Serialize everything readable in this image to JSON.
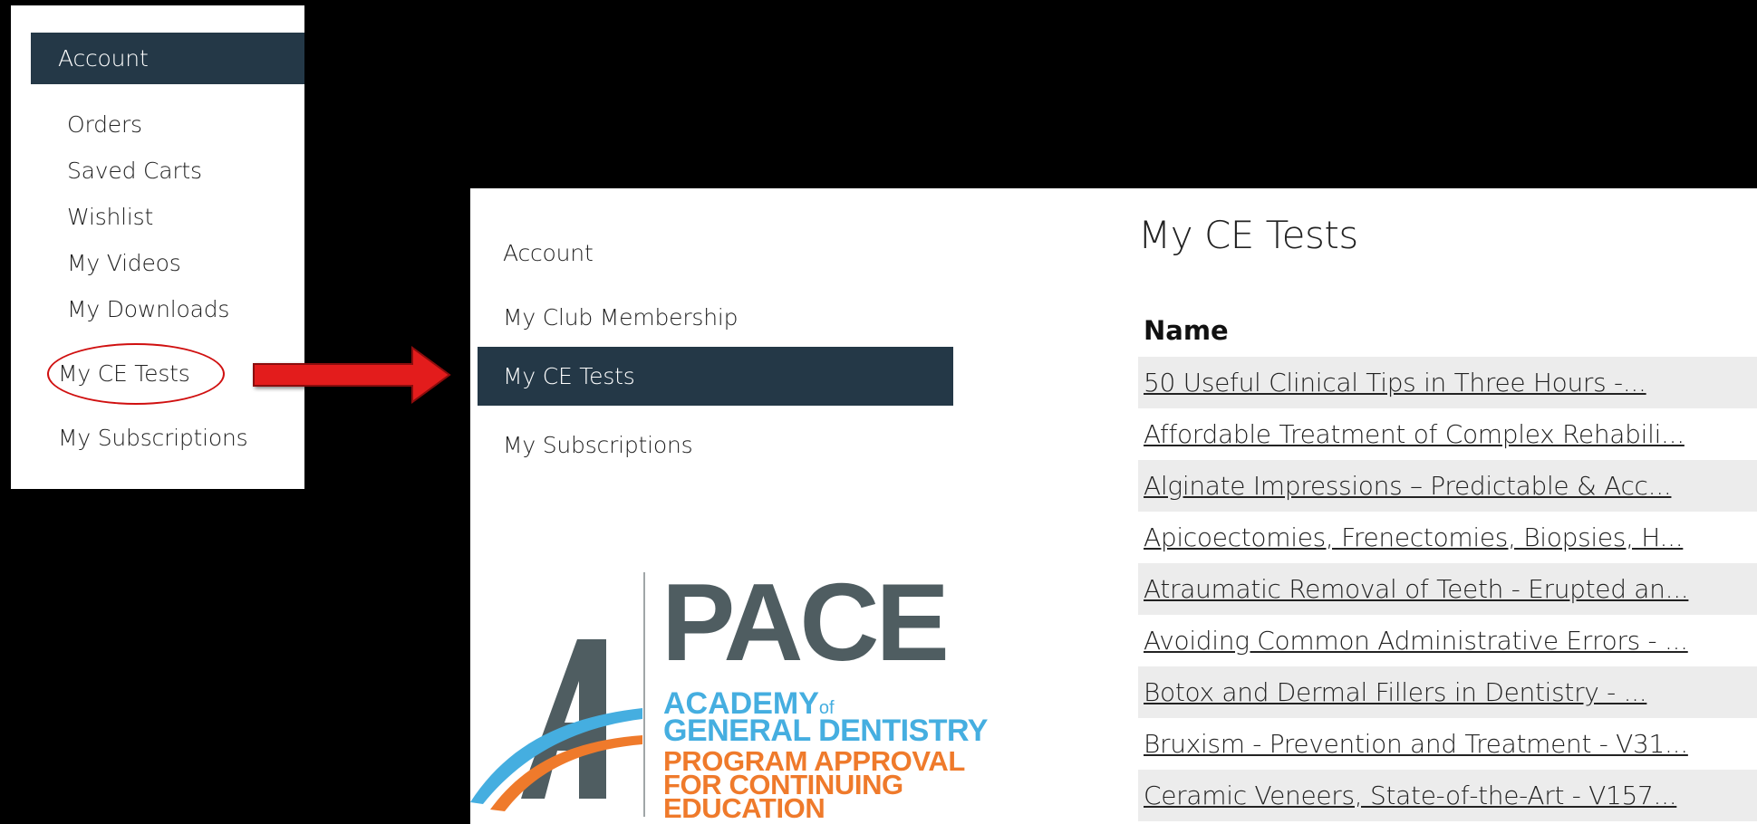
{
  "small_menu": {
    "header": "Account",
    "items": [
      "Orders",
      "Saved Carts",
      "Wishlist",
      "My Videos",
      "My Downloads",
      "My CE Tests",
      "My Subscriptions"
    ]
  },
  "sidebar": {
    "items": [
      "Account",
      "My Club Membership",
      "My CE Tests",
      "My Subscriptions"
    ]
  },
  "main": {
    "title": "My CE Tests",
    "column_header": "Name",
    "rows": [
      "50 Useful Clinical Tips in Three Hours -...",
      "Affordable Treatment of Complex Rehabili...",
      "Alginate Impressions – Predictable & Acc...",
      "Apicoectomies, Frenectomies, Biopsies, H...",
      "Atraumatic Removal of Teeth - Erupted an...",
      "Avoiding Common Administrative Errors - ...",
      "Botox and Dermal Fillers in Dentistry - ...",
      "Bruxism - Prevention and Treatment - V31...",
      "Ceramic Veneers, State-of-the-Art - V157..."
    ]
  },
  "logo": {
    "word": "PACE",
    "line1_a": "ACADEMY",
    "line1_of": "of",
    "line2": "GENERAL DENTISTRY",
    "line3": "PROGRAM APPROVAL",
    "line4": "FOR CONTINUING",
    "line5": "EDUCATION"
  },
  "colors": {
    "active_bg": "#243847",
    "highlight_circle": "#d01010",
    "arrow": "#e31b1b",
    "logo_blue": "#45aee0",
    "logo_orange": "#ef7a2b",
    "logo_gray": "#4f5d61"
  }
}
